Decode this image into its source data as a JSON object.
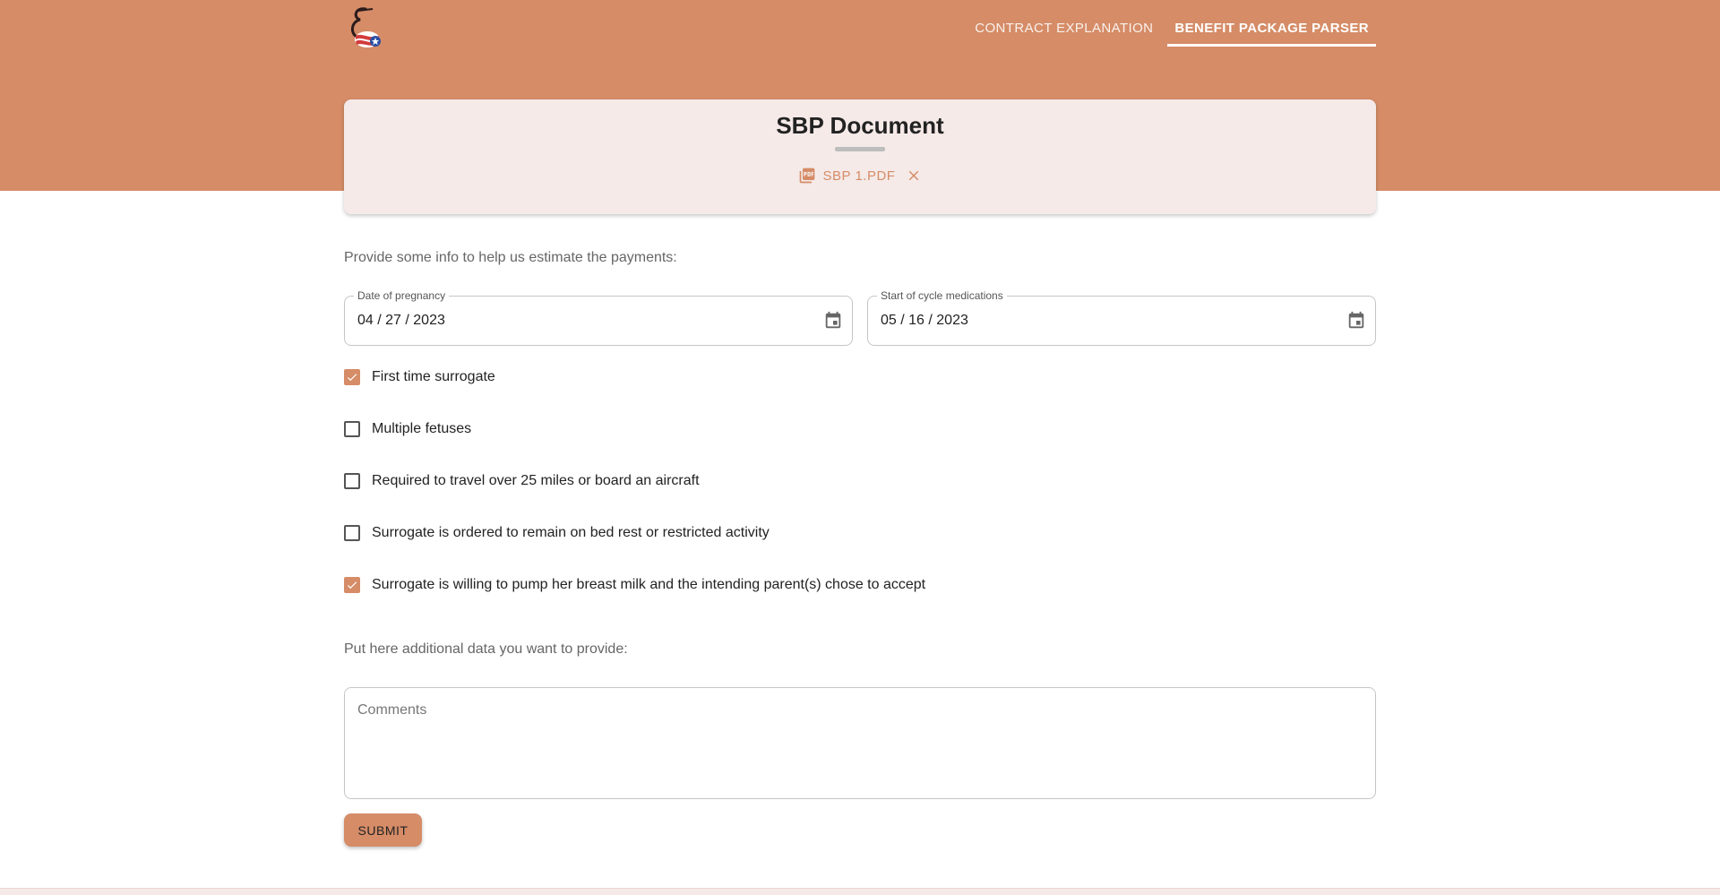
{
  "nav": {
    "tabs": [
      {
        "label": "CONTRACT EXPLANATION",
        "active": false
      },
      {
        "label": "BENEFIT PACKAGE PARSER",
        "active": true
      }
    ]
  },
  "document": {
    "title": "SBP Document",
    "file_name": "SBP 1.PDF",
    "file_icon": "pdf-icon",
    "remove_icon": "close-icon"
  },
  "form": {
    "intro": "Provide some info to help us estimate the payments:",
    "date_of_pregnancy": {
      "label": "Date of pregnancy",
      "value": "04 / 27 / 2023"
    },
    "start_of_cycle": {
      "label": "Start of cycle medications",
      "value": "05 / 16 / 2023"
    },
    "checkboxes": [
      {
        "label": "First time surrogate",
        "checked": true
      },
      {
        "label": "Multiple fetuses",
        "checked": false
      },
      {
        "label": "Required to travel over 25 miles or board an aircraft",
        "checked": false
      },
      {
        "label": "Surrogate is ordered to remain on bed rest or restricted activity",
        "checked": false
      },
      {
        "label": "Surrogate is willing to pump her breast milk and the intending parent(s) chose to accept",
        "checked": true
      }
    ],
    "extra_label": "Put here additional data you want to provide:",
    "comments_placeholder": "Comments",
    "submit_label": "SUBMIT"
  },
  "colors": {
    "brand": "#d58c67",
    "card_bg": "#f5eae8"
  }
}
